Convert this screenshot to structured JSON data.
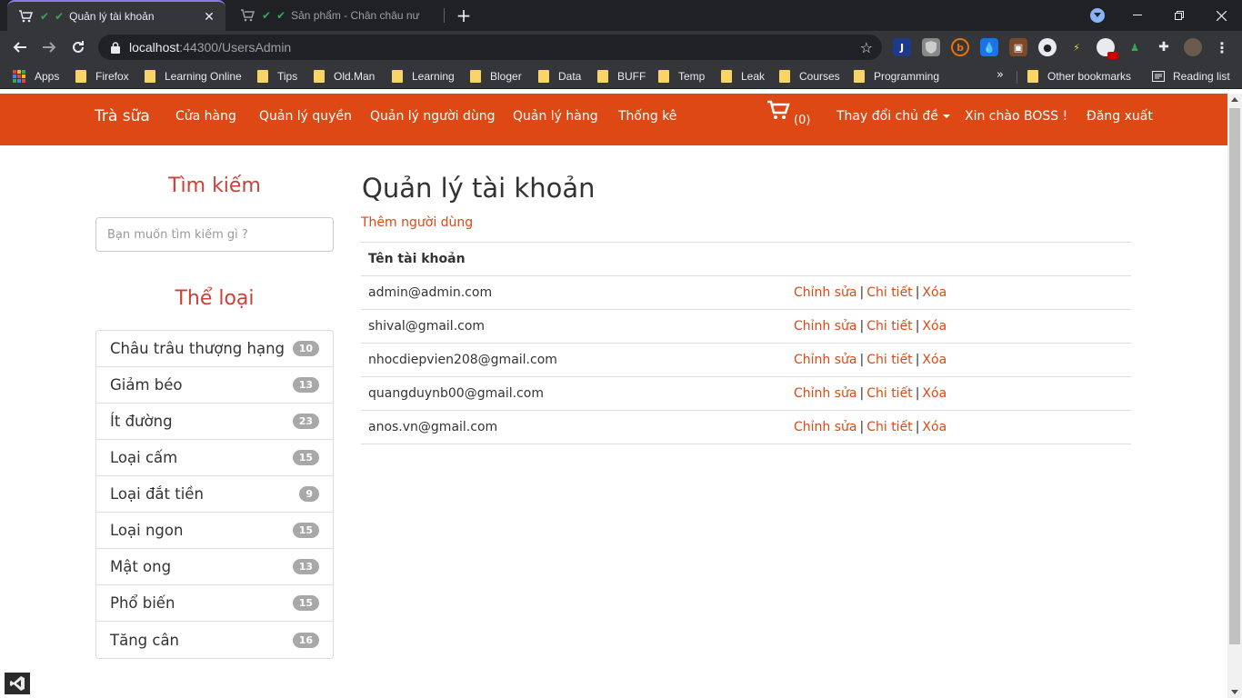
{
  "browser": {
    "tabs": [
      {
        "title": "Quản lý tài khoản",
        "active": true
      },
      {
        "title": "Sản phẩm - Chân châu nư",
        "active": false
      }
    ],
    "new_tab": "+",
    "url_host": "localhost",
    "url_rest": ":44300/UsersAdmin",
    "bookmarks": [
      "Apps",
      "Firefox",
      "Learning Online",
      "Tips",
      "Old.Man",
      "Learning",
      "Bloger",
      "Data",
      "BUFF",
      "Temp",
      "Leak",
      "Courses",
      "Programming"
    ],
    "bookmarks_more": "»",
    "other_bookmarks": "Other bookmarks",
    "reading_list": "Reading list"
  },
  "nav": {
    "brand": "Trà sữa",
    "links": [
      "Cửa hàng",
      "Quản lý quyền",
      "Quản lý người dùng",
      "Quản lý hàng",
      "Thống kê"
    ],
    "cart_count": "(0)",
    "theme": "Thay đổi chủ đề",
    "greeting": "Xin chào BOSS !",
    "logout": "Đăng xuất"
  },
  "sidebar": {
    "search_heading": "Tìm kiếm",
    "search_placeholder": "Bạn muốn tìm kiếm gì ?",
    "category_heading": "Thể loại",
    "categories": [
      {
        "name": "Châu trâu thượng hạng",
        "count": "10"
      },
      {
        "name": "Giảm béo",
        "count": "13"
      },
      {
        "name": "Ít đường",
        "count": "23"
      },
      {
        "name": "Loại cấm",
        "count": "15"
      },
      {
        "name": "Loại đắt tiền",
        "count": "9"
      },
      {
        "name": "Loại ngon",
        "count": "15"
      },
      {
        "name": "Mật ong",
        "count": "13"
      },
      {
        "name": "Phổ biến",
        "count": "15"
      },
      {
        "name": "Tăng cân",
        "count": "16"
      }
    ]
  },
  "main": {
    "title": "Quản lý tài khoản",
    "add_user": "Thêm người dùng",
    "column_header": "Tên tài khoản",
    "actions": {
      "edit": "Chỉnh sửa",
      "details": "Chi tiết",
      "delete": "Xóa",
      "separator": "|"
    },
    "users": [
      "admin@admin.com",
      "shival@gmail.com",
      "nhocdiepvien208@gmail.com",
      "quangduynb00@gmail.com",
      "anos.vn@gmail.com"
    ]
  },
  "colors": {
    "brand": "#dd4814",
    "heading": "#c9423a",
    "badge": "#a8a8a8",
    "chrome_dark": "#202124",
    "chrome_toolbar": "#35363a"
  }
}
